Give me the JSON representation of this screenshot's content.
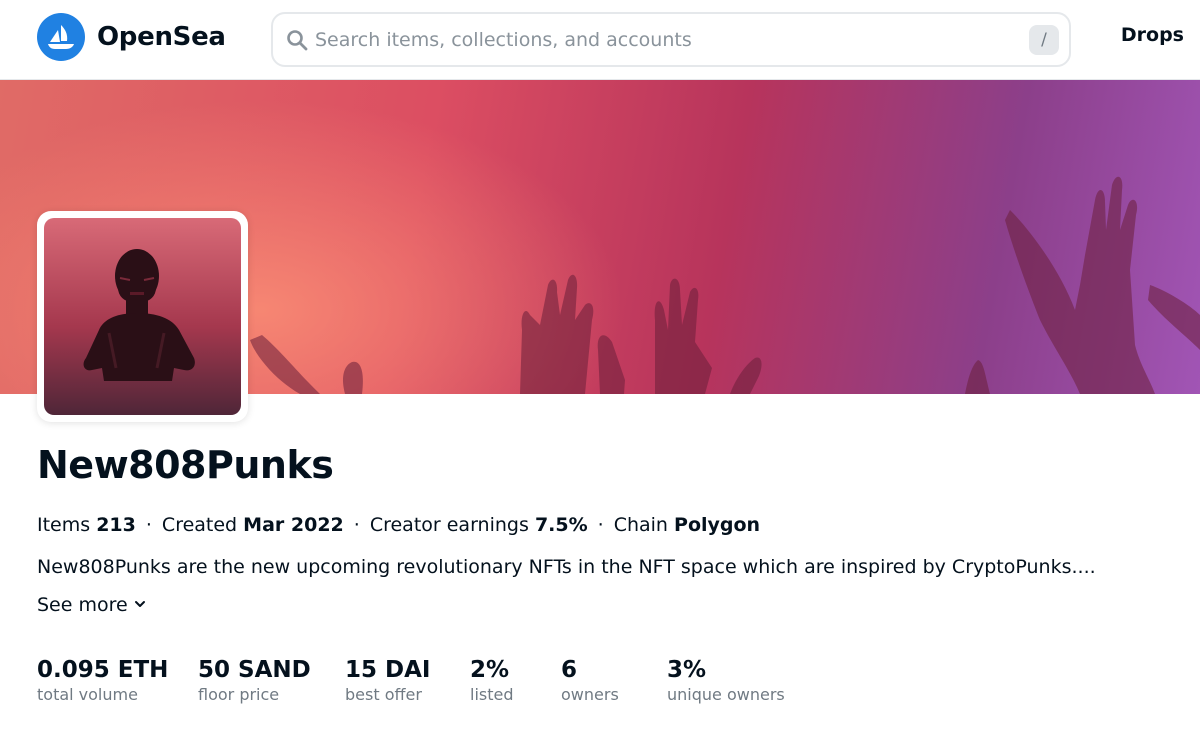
{
  "header": {
    "brand_name": "OpenSea",
    "search": {
      "placeholder": "Search items, collections, and accounts",
      "shortcut_key": "/"
    },
    "nav": {
      "drops": "Drops"
    }
  },
  "collection": {
    "name": "New808Punks",
    "meta": {
      "items_label": "Items",
      "items_value": "213",
      "created_label": "Created",
      "created_value": "Mar 2022",
      "earnings_label": "Creator earnings",
      "earnings_value": "7.5%",
      "chain_label": "Chain",
      "chain_value": "Polygon",
      "separator": "·"
    },
    "description": "New808Punks are the new upcoming revolutionary NFTs in the NFT space which are inspired by CryptoPunks....",
    "see_more": "See more",
    "stats": [
      {
        "value": "0.095 ETH",
        "label": "total volume"
      },
      {
        "value": "50 SAND",
        "label": "floor price"
      },
      {
        "value": "15 DAI",
        "label": "best offer"
      },
      {
        "value": "2%",
        "label": "listed"
      },
      {
        "value": "6",
        "label": "owners"
      },
      {
        "value": "3%",
        "label": "unique owners"
      }
    ]
  },
  "colors": {
    "brand_blue": "#2081e2",
    "text_primary": "#04111d",
    "text_secondary": "#707a83",
    "border": "#e5e8eb"
  },
  "icons": [
    "opensea-logo-icon",
    "search-icon",
    "chevron-down-icon"
  ]
}
